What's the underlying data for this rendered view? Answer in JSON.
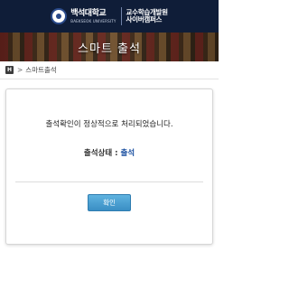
{
  "header": {
    "logo_main": "백석대학교",
    "logo_sub": "BAEKSEOK UNIVERSITY",
    "logo_right_line1": "교수학습개발원",
    "logo_right_line2": "사이버캠퍼스"
  },
  "banner": {
    "title": "스마트 출석"
  },
  "breadcrumb": {
    "home_icon_label": "H",
    "separator": ">",
    "current": "스마트출석"
  },
  "card": {
    "message": "출석확인이 정상적으로 처리되었습니다.",
    "status_label": "출석상태 :",
    "status_value": "출석",
    "confirm_label": "확인"
  },
  "colors": {
    "header_bg": "#0f1d38",
    "status_value": "#1a4fa0",
    "button": "#3a8ec4"
  }
}
